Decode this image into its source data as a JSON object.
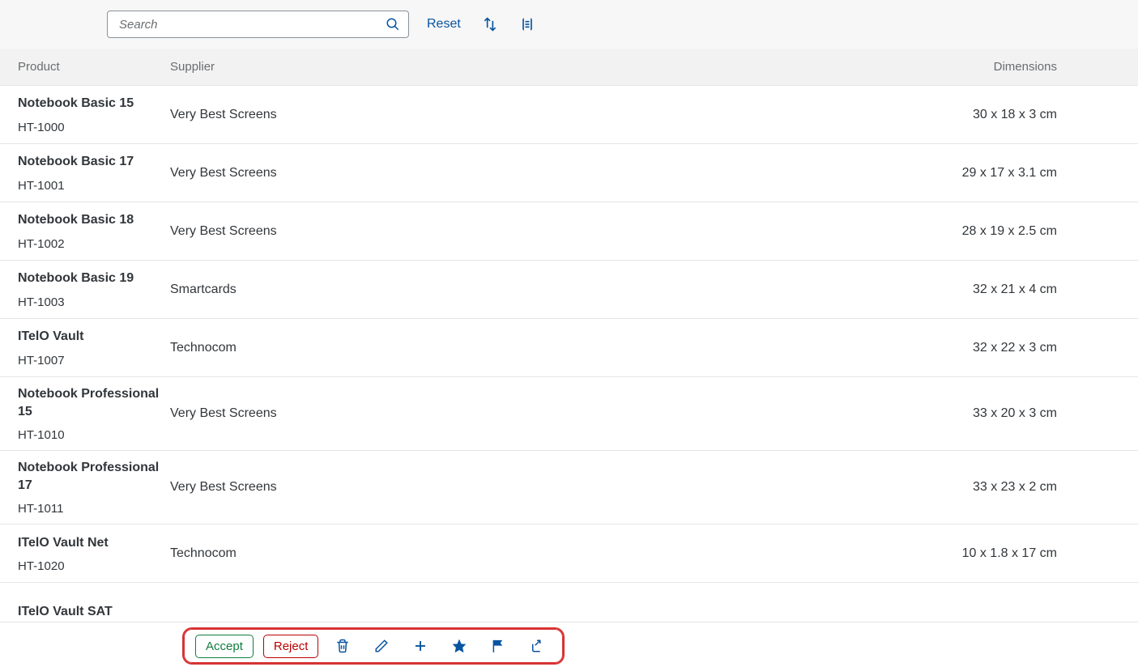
{
  "toolbar": {
    "search_placeholder": "Search",
    "reset_label": "Reset"
  },
  "columns": {
    "product": "Product",
    "supplier": "Supplier",
    "dimensions": "Dimensions"
  },
  "rows": [
    {
      "name": "Notebook Basic 15",
      "id": "HT-1000",
      "supplier": "Very Best Screens",
      "dimensions": "30 x 18 x 3 cm"
    },
    {
      "name": "Notebook Basic 17",
      "id": "HT-1001",
      "supplier": "Very Best Screens",
      "dimensions": "29 x 17 x 3.1 cm"
    },
    {
      "name": "Notebook Basic 18",
      "id": "HT-1002",
      "supplier": "Very Best Screens",
      "dimensions": "28 x 19 x 2.5 cm"
    },
    {
      "name": "Notebook Basic 19",
      "id": "HT-1003",
      "supplier": "Smartcards",
      "dimensions": "32 x 21 x 4 cm"
    },
    {
      "name": "ITelO Vault",
      "id": "HT-1007",
      "supplier": "Technocom",
      "dimensions": "32 x 22 x 3 cm"
    },
    {
      "name": "Notebook Professional 15",
      "id": "HT-1010",
      "supplier": "Very Best Screens",
      "dimensions": "33 x 20 x 3 cm"
    },
    {
      "name": "Notebook Professional 17",
      "id": "HT-1011",
      "supplier": "Very Best Screens",
      "dimensions": "33 x 23 x 2 cm"
    },
    {
      "name": "ITelO Vault Net",
      "id": "HT-1020",
      "supplier": "Technocom",
      "dimensions": "10 x 1.8 x 17 cm"
    },
    {
      "name": "ITelO Vault SAT",
      "id": "",
      "supplier": "",
      "dimensions": ""
    }
  ],
  "footer": {
    "accept_label": "Accept",
    "reject_label": "Reject"
  }
}
